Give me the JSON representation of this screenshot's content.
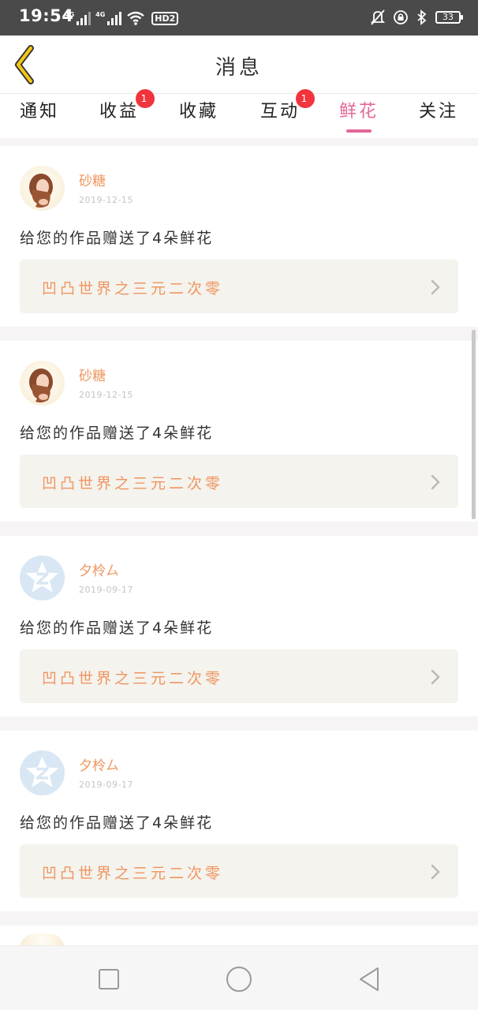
{
  "status_bar": {
    "time": "19:54",
    "signal_1_label": "4G",
    "signal_2_label": "4G",
    "hd_label": "HD2",
    "battery": "33"
  },
  "header": {
    "title": "消息"
  },
  "tabs": [
    {
      "label": "通知",
      "badge": ""
    },
    {
      "label": "收益",
      "badge": "1"
    },
    {
      "label": "收藏",
      "badge": ""
    },
    {
      "label": "互动",
      "badge": "1"
    },
    {
      "label": "鲜花",
      "badge": "",
      "active": true
    },
    {
      "label": "关注",
      "badge": ""
    }
  ],
  "messages": [
    {
      "user": "砂糖",
      "date": "2019-12-15",
      "text": "给您的作品赠送了4朵鲜花",
      "work": "凹凸世界之三元二次零",
      "avatar": "photo"
    },
    {
      "user": "砂糖",
      "date": "2019-12-15",
      "text": "给您的作品赠送了4朵鲜花",
      "work": "凹凸世界之三元二次零",
      "avatar": "photo"
    },
    {
      "user": "夕柃ㄙ",
      "date": "2019-09-17",
      "text": "给您的作品赠送了4朵鲜花",
      "work": "凹凸世界之三元二次零",
      "avatar": "qq"
    },
    {
      "user": "夕柃ㄙ",
      "date": "2019-09-17",
      "text": "给您的作品赠送了4朵鲜花",
      "work": "凹凸世界之三元二次零",
      "avatar": "qq"
    }
  ],
  "colors": {
    "accent": "#e2699a",
    "username": "#f0955f",
    "badge": "#f2343c",
    "back_arrow": "#f5c518"
  }
}
